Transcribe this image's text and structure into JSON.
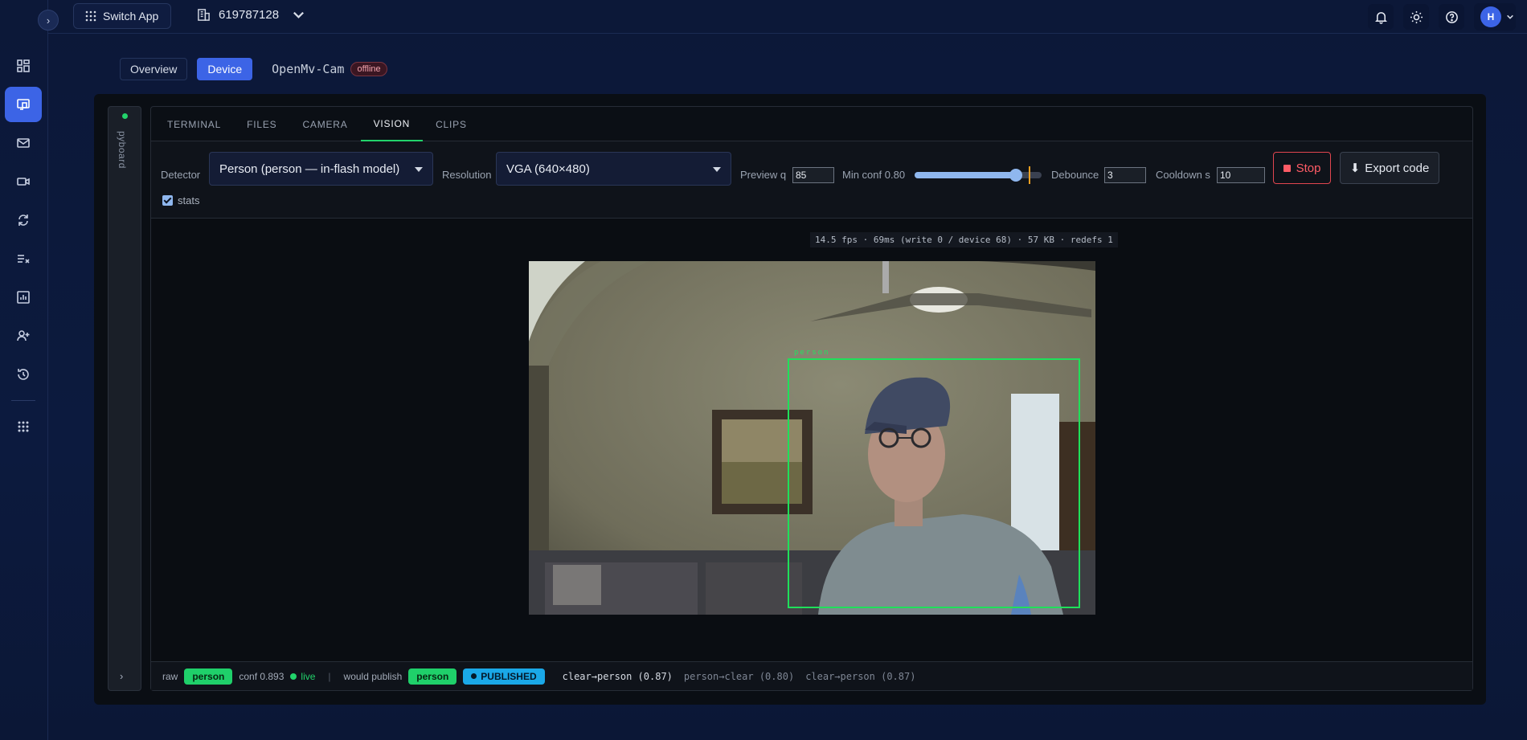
{
  "topbar": {
    "switch_app_label": "Switch App",
    "org_id": "619787128",
    "avatar_initial": "H"
  },
  "rail": {
    "items": [
      "dashboard-icon",
      "devices-icon",
      "mail-icon",
      "video-icon",
      "sync-icon",
      "tasks-icon",
      "analytics-icon",
      "add-user-icon",
      "history-icon",
      "apps-icon"
    ],
    "active_index": 1
  },
  "crumbs": {
    "overview_label": "Overview",
    "device_label": "Device",
    "device_name": "OpenMv-Cam",
    "status_badge": "offline"
  },
  "side": {
    "board_label": "pyboard"
  },
  "tabs": [
    {
      "label": "TERMINAL"
    },
    {
      "label": "FILES"
    },
    {
      "label": "CAMERA"
    },
    {
      "label": "VISION",
      "active": true
    },
    {
      "label": "CLIPS"
    }
  ],
  "controls": {
    "detector_label": "Detector",
    "detector_value": "Person (person — in-flash model)",
    "resolution_label": "Resolution",
    "resolution_value": "VGA (640×480)",
    "preview_q_label": "Preview q",
    "preview_q_value": "85",
    "min_conf_label": "Min conf 0.80",
    "min_conf_value": 0.8,
    "debounce_label": "Debounce",
    "debounce_value": "3",
    "cooldown_label": "Cooldown s",
    "cooldown_value": "10",
    "stop_label": "Stop",
    "export_label": "Export code",
    "stats_label": "stats",
    "stats_checked": true
  },
  "stage": {
    "overlay_text": "14.5 fps · 69ms (write 0 / device 68) · 57 KB · redefs 1",
    "detection_label": "person"
  },
  "bottom": {
    "raw_label": "raw",
    "raw_class": "person",
    "conf_text": "conf 0.893",
    "live_text": "live",
    "separator": "|",
    "would_publish_label": "would publish",
    "publish_class": "person",
    "published_badge": "PUBLISHED",
    "events": [
      "clear→person (0.87)",
      "person→clear (0.80)",
      "clear→person (0.87)"
    ]
  },
  "colors": {
    "accent": "#3c64e6",
    "live_green": "#22d36b",
    "detection_green": "#1fe05a",
    "stop_red": "#ff5c66",
    "published_blue": "#1aa8e8"
  }
}
